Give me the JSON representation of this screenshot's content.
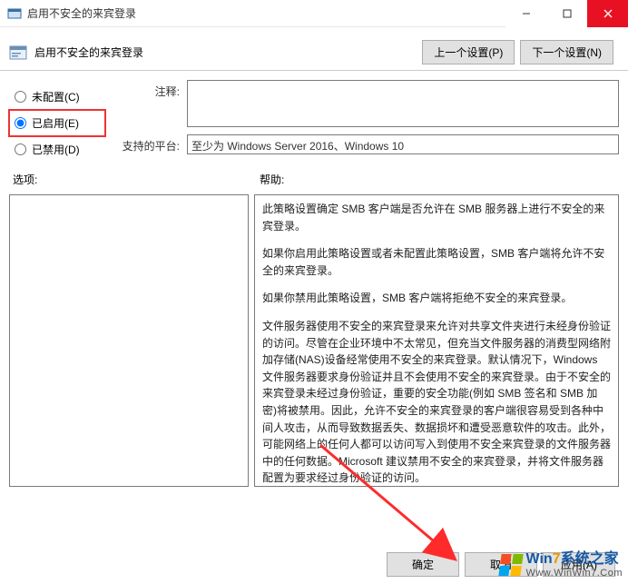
{
  "window": {
    "title": "启用不安全的来宾登录"
  },
  "header": {
    "policy_title": "启用不安全的来宾登录",
    "prev_btn": "上一个设置(P)",
    "next_btn": "下一个设置(N)"
  },
  "radios": {
    "not_configured": "未配置(C)",
    "enabled": "已启用(E)",
    "disabled": "已禁用(D)",
    "selected": "enabled"
  },
  "fields": {
    "comment_label": "注释:",
    "comment_value": "",
    "platform_label": "支持的平台:",
    "platform_value": "至少为 Windows Server 2016、Windows 10"
  },
  "labels": {
    "options": "选项:",
    "help": "帮助:"
  },
  "help": {
    "p1": "此策略设置确定 SMB 客户端是否允许在 SMB 服务器上进行不安全的来宾登录。",
    "p2": "如果你启用此策略设置或者未配置此策略设置，SMB 客户端将允许不安全的来宾登录。",
    "p3": "如果你禁用此策略设置，SMB 客户端将拒绝不安全的来宾登录。",
    "p4": "文件服务器使用不安全的来宾登录来允许对共享文件夹进行未经身份验证的访问。尽管在企业环境中不太常见，但充当文件服务器的消费型网络附加存储(NAS)设备经常使用不安全的来宾登录。默认情况下，Windows 文件服务器要求身份验证并且不会使用不安全的来宾登录。由于不安全的来宾登录未经过身份验证，重要的安全功能(例如 SMB 签名和 SMB 加密)将被禁用。因此，允许不安全的来宾登录的客户端很容易受到各种中间人攻击，从而导致数据丢失、数据损坏和遭受恶意软件的攻击。此外，可能网络上的任何人都可以访问写入到使用不安全来宾登录的文件服务器中的任何数据。Microsoft 建议禁用不安全的来宾登录，并将文件服务器配置为要求经过身份验证的访问。"
  },
  "footer": {
    "ok": "确定",
    "cancel": "取消",
    "apply": "应用(A)"
  },
  "watermark": {
    "line1a": "Win",
    "line1b": "7",
    "line1c": "系统之家",
    "line2": "Www.WinWin7.Com"
  }
}
